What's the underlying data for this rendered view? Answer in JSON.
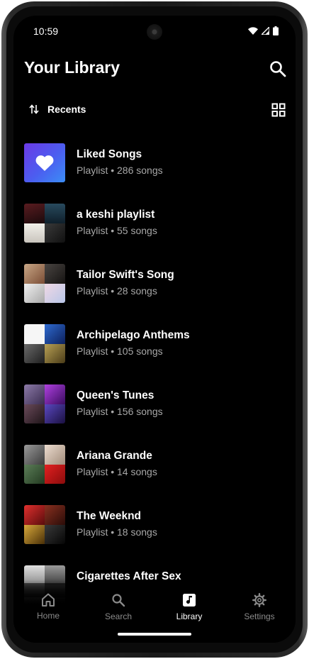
{
  "status_bar": {
    "time": "10:59"
  },
  "header": {
    "title": "Your Library"
  },
  "sort": {
    "label": "Recents"
  },
  "playlists": [
    {
      "name": "Liked Songs",
      "meta": "Playlist • 286 songs",
      "colors": [
        "#6b39e6",
        "#3b8ef6"
      ]
    },
    {
      "name": "a keshi playlist",
      "meta": "Playlist • 55 songs",
      "colors": [
        "#3a1417",
        "#1d3a4c",
        "#e8e5e0",
        "#222222"
      ]
    },
    {
      "name": "Tailor Swift's Song",
      "meta": "Playlist • 28 songs",
      "colors": [
        "#b38d6f",
        "#2a2725",
        "#dcdcdc",
        "#e6c4d4"
      ]
    },
    {
      "name": "Archipelago Anthems",
      "meta": "Playlist • 105 songs",
      "colors": [
        "#f4f4f4",
        "#1f4ca8",
        "#3a3a3a",
        "#8f7b3f"
      ]
    },
    {
      "name": "Queen's Tunes",
      "meta": "Playlist • 156 songs",
      "colors": [
        "#5a4a72",
        "#7a2fb0",
        "#3a2a40",
        "#3b2a78"
      ]
    },
    {
      "name": "Ariana Grande",
      "meta": "Playlist • 14 songs",
      "colors": [
        "#777777",
        "#d9c7b8",
        "#4c6d48",
        "#d11a1a"
      ]
    },
    {
      "name": "The Weeknd",
      "meta": "Playlist • 18 songs",
      "colors": [
        "#c0262a",
        "#6a2218",
        "#c79a2a",
        "#1a1a1a"
      ]
    },
    {
      "name": "Cigarettes After Sex",
      "meta": "",
      "colors": [
        "#d0d0d0",
        "#6a6a6a",
        "#9a9a9a",
        "#2a2a2a"
      ]
    }
  ],
  "nav": {
    "home": "Home",
    "search": "Search",
    "library": "Library",
    "settings": "Settings"
  },
  "colors": {
    "background": "#000000",
    "text_primary": "#ffffff",
    "text_secondary": "#a7a7a7",
    "nav_inactive": "#8a8a8a"
  }
}
